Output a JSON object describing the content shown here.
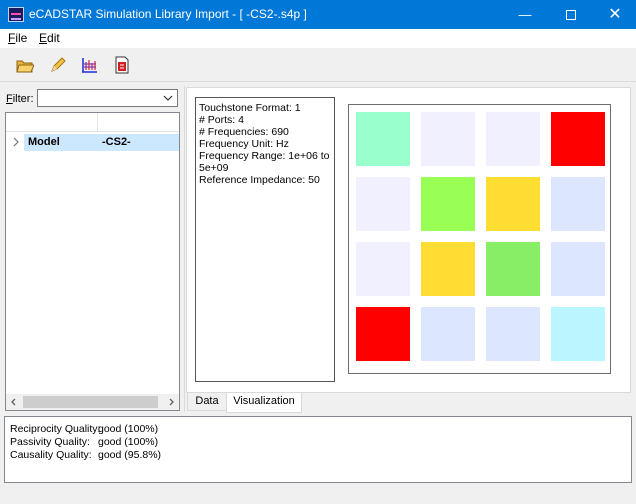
{
  "window": {
    "title": "eCADSTAR Simulation Library Import - [ -CS2-.s4p ]"
  },
  "menu": {
    "file": "File",
    "edit": "Edit"
  },
  "toolbar": {
    "icons": [
      "open-folder-icon",
      "pencil-icon",
      "plot-icon",
      "pdf-document-icon"
    ]
  },
  "filter": {
    "label": "Filter:",
    "value": ""
  },
  "tree": {
    "rows": [
      {
        "name": "Model",
        "value": "-CS2-"
      }
    ]
  },
  "info": {
    "lines": [
      "Touchstone Format: 1",
      "# Ports: 4",
      "# Frequencies: 690",
      "Frequency Unit: Hz",
      "Frequency Range: 1e+06 to",
      "5e+09",
      "Reference Impedance: 50"
    ]
  },
  "visualization": {
    "grid": [
      [
        "#99ffcc",
        "#f0f0ff",
        "#f0f0ff",
        "#ff0000"
      ],
      [
        "#f0f0ff",
        "#99ff55",
        "#ffdd33",
        "#dde6ff"
      ],
      [
        "#f0f0ff",
        "#ffdd33",
        "#88ee66",
        "#dde6ff"
      ],
      [
        "#ff0000",
        "#dde6ff",
        "#dde6ff",
        "#bbf5ff"
      ]
    ]
  },
  "tabs": {
    "data": "Data",
    "visualization": "Visualization"
  },
  "quality": [
    {
      "label": "Reciprocity Quality:",
      "value": "good (100%)"
    },
    {
      "label": "Passivity Quality:",
      "value": "good (100%)"
    },
    {
      "label": "Causality Quality:",
      "value": "good (95.8%)"
    }
  ]
}
